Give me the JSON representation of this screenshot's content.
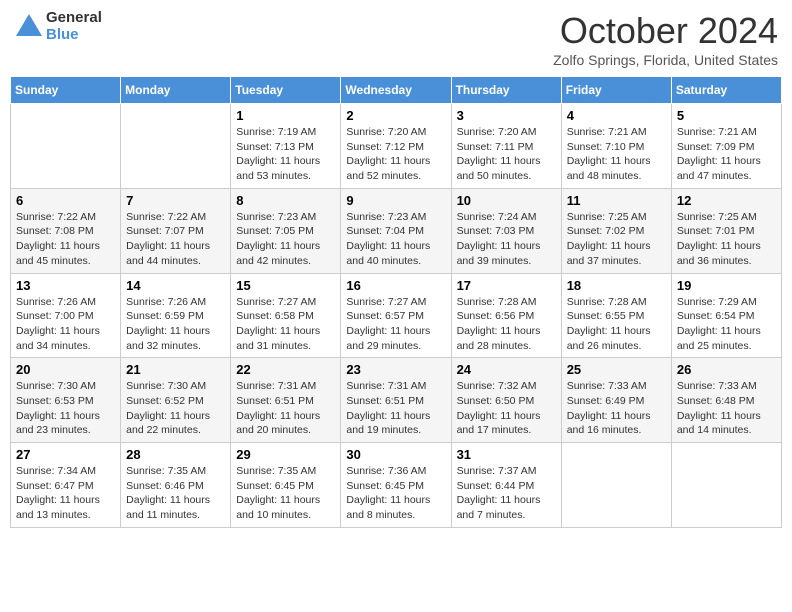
{
  "logo": {
    "general": "General",
    "blue": "Blue"
  },
  "header": {
    "month": "October 2024",
    "location": "Zolfo Springs, Florida, United States"
  },
  "days_of_week": [
    "Sunday",
    "Monday",
    "Tuesday",
    "Wednesday",
    "Thursday",
    "Friday",
    "Saturday"
  ],
  "weeks": [
    [
      {
        "day": "",
        "sunrise": "",
        "sunset": "",
        "daylight": ""
      },
      {
        "day": "",
        "sunrise": "",
        "sunset": "",
        "daylight": ""
      },
      {
        "day": "1",
        "sunrise": "Sunrise: 7:19 AM",
        "sunset": "Sunset: 7:13 PM",
        "daylight": "Daylight: 11 hours and 53 minutes."
      },
      {
        "day": "2",
        "sunrise": "Sunrise: 7:20 AM",
        "sunset": "Sunset: 7:12 PM",
        "daylight": "Daylight: 11 hours and 52 minutes."
      },
      {
        "day": "3",
        "sunrise": "Sunrise: 7:20 AM",
        "sunset": "Sunset: 7:11 PM",
        "daylight": "Daylight: 11 hours and 50 minutes."
      },
      {
        "day": "4",
        "sunrise": "Sunrise: 7:21 AM",
        "sunset": "Sunset: 7:10 PM",
        "daylight": "Daylight: 11 hours and 48 minutes."
      },
      {
        "day": "5",
        "sunrise": "Sunrise: 7:21 AM",
        "sunset": "Sunset: 7:09 PM",
        "daylight": "Daylight: 11 hours and 47 minutes."
      }
    ],
    [
      {
        "day": "6",
        "sunrise": "Sunrise: 7:22 AM",
        "sunset": "Sunset: 7:08 PM",
        "daylight": "Daylight: 11 hours and 45 minutes."
      },
      {
        "day": "7",
        "sunrise": "Sunrise: 7:22 AM",
        "sunset": "Sunset: 7:07 PM",
        "daylight": "Daylight: 11 hours and 44 minutes."
      },
      {
        "day": "8",
        "sunrise": "Sunrise: 7:23 AM",
        "sunset": "Sunset: 7:05 PM",
        "daylight": "Daylight: 11 hours and 42 minutes."
      },
      {
        "day": "9",
        "sunrise": "Sunrise: 7:23 AM",
        "sunset": "Sunset: 7:04 PM",
        "daylight": "Daylight: 11 hours and 40 minutes."
      },
      {
        "day": "10",
        "sunrise": "Sunrise: 7:24 AM",
        "sunset": "Sunset: 7:03 PM",
        "daylight": "Daylight: 11 hours and 39 minutes."
      },
      {
        "day": "11",
        "sunrise": "Sunrise: 7:25 AM",
        "sunset": "Sunset: 7:02 PM",
        "daylight": "Daylight: 11 hours and 37 minutes."
      },
      {
        "day": "12",
        "sunrise": "Sunrise: 7:25 AM",
        "sunset": "Sunset: 7:01 PM",
        "daylight": "Daylight: 11 hours and 36 minutes."
      }
    ],
    [
      {
        "day": "13",
        "sunrise": "Sunrise: 7:26 AM",
        "sunset": "Sunset: 7:00 PM",
        "daylight": "Daylight: 11 hours and 34 minutes."
      },
      {
        "day": "14",
        "sunrise": "Sunrise: 7:26 AM",
        "sunset": "Sunset: 6:59 PM",
        "daylight": "Daylight: 11 hours and 32 minutes."
      },
      {
        "day": "15",
        "sunrise": "Sunrise: 7:27 AM",
        "sunset": "Sunset: 6:58 PM",
        "daylight": "Daylight: 11 hours and 31 minutes."
      },
      {
        "day": "16",
        "sunrise": "Sunrise: 7:27 AM",
        "sunset": "Sunset: 6:57 PM",
        "daylight": "Daylight: 11 hours and 29 minutes."
      },
      {
        "day": "17",
        "sunrise": "Sunrise: 7:28 AM",
        "sunset": "Sunset: 6:56 PM",
        "daylight": "Daylight: 11 hours and 28 minutes."
      },
      {
        "day": "18",
        "sunrise": "Sunrise: 7:28 AM",
        "sunset": "Sunset: 6:55 PM",
        "daylight": "Daylight: 11 hours and 26 minutes."
      },
      {
        "day": "19",
        "sunrise": "Sunrise: 7:29 AM",
        "sunset": "Sunset: 6:54 PM",
        "daylight": "Daylight: 11 hours and 25 minutes."
      }
    ],
    [
      {
        "day": "20",
        "sunrise": "Sunrise: 7:30 AM",
        "sunset": "Sunset: 6:53 PM",
        "daylight": "Daylight: 11 hours and 23 minutes."
      },
      {
        "day": "21",
        "sunrise": "Sunrise: 7:30 AM",
        "sunset": "Sunset: 6:52 PM",
        "daylight": "Daylight: 11 hours and 22 minutes."
      },
      {
        "day": "22",
        "sunrise": "Sunrise: 7:31 AM",
        "sunset": "Sunset: 6:51 PM",
        "daylight": "Daylight: 11 hours and 20 minutes."
      },
      {
        "day": "23",
        "sunrise": "Sunrise: 7:31 AM",
        "sunset": "Sunset: 6:51 PM",
        "daylight": "Daylight: 11 hours and 19 minutes."
      },
      {
        "day": "24",
        "sunrise": "Sunrise: 7:32 AM",
        "sunset": "Sunset: 6:50 PM",
        "daylight": "Daylight: 11 hours and 17 minutes."
      },
      {
        "day": "25",
        "sunrise": "Sunrise: 7:33 AM",
        "sunset": "Sunset: 6:49 PM",
        "daylight": "Daylight: 11 hours and 16 minutes."
      },
      {
        "day": "26",
        "sunrise": "Sunrise: 7:33 AM",
        "sunset": "Sunset: 6:48 PM",
        "daylight": "Daylight: 11 hours and 14 minutes."
      }
    ],
    [
      {
        "day": "27",
        "sunrise": "Sunrise: 7:34 AM",
        "sunset": "Sunset: 6:47 PM",
        "daylight": "Daylight: 11 hours and 13 minutes."
      },
      {
        "day": "28",
        "sunrise": "Sunrise: 7:35 AM",
        "sunset": "Sunset: 6:46 PM",
        "daylight": "Daylight: 11 hours and 11 minutes."
      },
      {
        "day": "29",
        "sunrise": "Sunrise: 7:35 AM",
        "sunset": "Sunset: 6:45 PM",
        "daylight": "Daylight: 11 hours and 10 minutes."
      },
      {
        "day": "30",
        "sunrise": "Sunrise: 7:36 AM",
        "sunset": "Sunset: 6:45 PM",
        "daylight": "Daylight: 11 hours and 8 minutes."
      },
      {
        "day": "31",
        "sunrise": "Sunrise: 7:37 AM",
        "sunset": "Sunset: 6:44 PM",
        "daylight": "Daylight: 11 hours and 7 minutes."
      },
      {
        "day": "",
        "sunrise": "",
        "sunset": "",
        "daylight": ""
      },
      {
        "day": "",
        "sunrise": "",
        "sunset": "",
        "daylight": ""
      }
    ]
  ]
}
